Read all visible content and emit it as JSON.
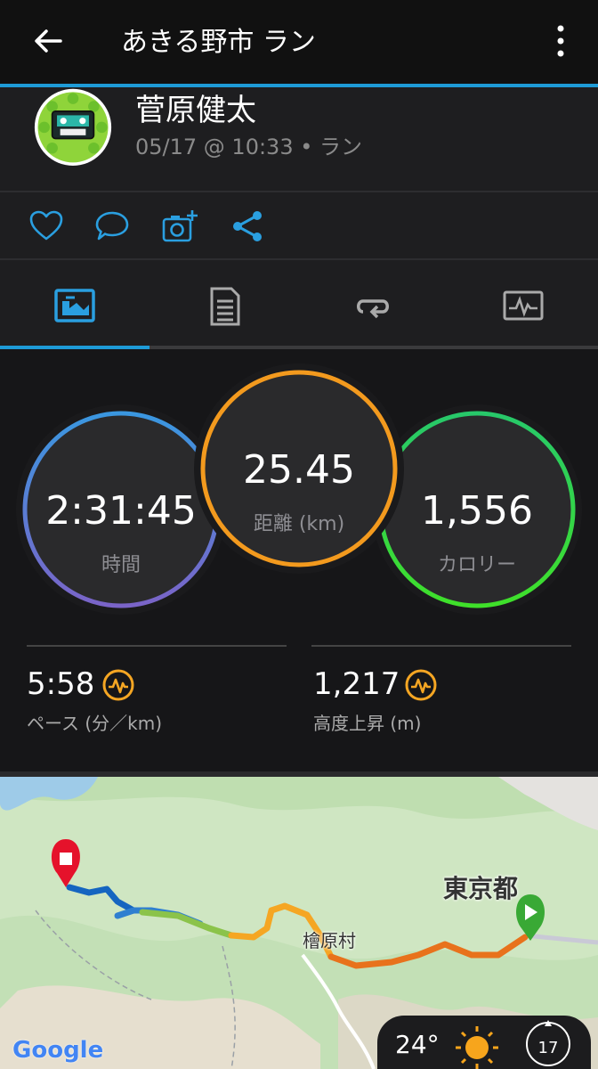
{
  "header": {
    "title": "あきる野市 ラン"
  },
  "profile": {
    "name": "菅原健太",
    "meta": "05/17 @ 10:33 • ラン"
  },
  "stats": {
    "time": {
      "value": "2:31:45",
      "label": "時間"
    },
    "distance": {
      "value": "25.45",
      "label": "距離 (km)"
    },
    "calories": {
      "value": "1,556",
      "label": "カロリー"
    },
    "pace": {
      "value": "5:58",
      "label": "ペース (分／km)"
    },
    "elevation": {
      "value": "1,217",
      "label": "高度上昇 (m)"
    }
  },
  "map": {
    "place_tokyo": "東京都",
    "place_village": "檜原村",
    "google": "Google",
    "temperature": "24°",
    "wind": "17"
  },
  "colors": {
    "accent": "#1e9bd7",
    "ring_time": "#3a8fd6",
    "ring_distance": "#f39a1e",
    "ring_calories": "#2ed24a"
  }
}
